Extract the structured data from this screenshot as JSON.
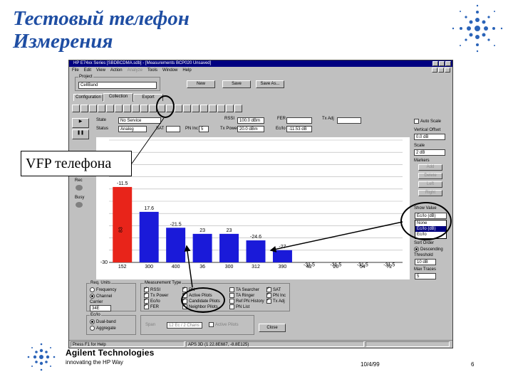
{
  "slide": {
    "title_line1": "Тестовый телефон",
    "title_line2": "Измерения",
    "callout": "VFP телефона",
    "footer": {
      "brand": "Agilent Technologies",
      "tagline": "innovating the HP Way",
      "date": "10/4/99",
      "page": "6"
    }
  },
  "window": {
    "title": "HP E74xx Series [SBDBCDMA.sdb] - [Measurements  BCP020  Unsaved]",
    "menu": [
      "File",
      "Edit",
      "View",
      "Action",
      "Analyze",
      "Tools",
      "Window",
      "Help"
    ],
    "project": {
      "label": "Project",
      "value": "CellBand",
      "buttons": [
        "New",
        "Save",
        "Save As..."
      ]
    },
    "tabs": [
      "Configuration",
      "Collection",
      "Export"
    ],
    "active_tab": "Collection",
    "fields": {
      "state_label": "State",
      "state_value": "No Service",
      "status_label": "Status",
      "status_value": "Analog",
      "sat_label": "SAT",
      "pn_inc_label": "PN Inc",
      "pn_inc_value": "5",
      "rssi_label": "RSSI",
      "rssi_value": "100.0 dBm",
      "tx_power_label": "Tx Power",
      "tx_power_value": "20.0 dBm",
      "fer_label": "FER",
      "ecio_label": "Ec/Io",
      "ecio_value": "-11.53 dB",
      "txadj_label": "Tx Adj"
    },
    "left_strip": [
      "Rec",
      "Busy"
    ],
    "right_panel": {
      "auto_scale": "Auto Scale",
      "vertical_offset_label": "Vertical Offset",
      "vertical_offset_value": "0.0 dB",
      "scale_label": "Scale",
      "scale_value": "2 dB",
      "markers_label": "Markers",
      "marker_buttons": [
        "Add",
        "Delete",
        "Left",
        "Right"
      ],
      "show_value_label": "Show Value",
      "show_value_selected": "Ec/Io (dB)",
      "show_value_options": [
        "None",
        "Ec/Io (dB)",
        "Ec/Io"
      ],
      "sort_label": "Sort Order",
      "sort_value": "Descending",
      "threshold_label": "Threshold",
      "threshold_value": "10 dB",
      "max_traces_label": "Max Traces",
      "max_traces_value": "5"
    },
    "req_units": {
      "label": "Req. Units",
      "options": [
        "Frequency",
        "Channel"
      ],
      "selected": "Channel",
      "carrier_label": "Carrier",
      "carrier_value": "34E"
    },
    "measurement_types": {
      "label": "Measurement Type",
      "items": [
        {
          "label": "RSSI",
          "on": true
        },
        {
          "label": "Tx Power",
          "on": true
        },
        {
          "label": "Ec/Io",
          "on": true
        },
        {
          "label": "FER",
          "on": true
        },
        {
          "label": "PN",
          "on": true
        },
        {
          "label": "Active Pilots",
          "on": true
        },
        {
          "label": "Candidate Pilots",
          "on": true
        },
        {
          "label": "Neighbor Pilots",
          "on": true
        },
        {
          "label": "TA Searcher",
          "on": false
        },
        {
          "label": "TA Ringer",
          "on": false
        },
        {
          "label": "Ref PN History",
          "on": false
        },
        {
          "label": "PN List",
          "on": false
        },
        {
          "label": "SAT",
          "on": true
        },
        {
          "label": "PN Inc",
          "on": true
        },
        {
          "label": "Tx Adj",
          "on": true
        }
      ]
    },
    "ecio_mode": {
      "label": "Ec/Io",
      "options": [
        "Dual-band",
        "Aggregate"
      ],
      "selected": "Dual-band"
    },
    "span": {
      "label": "Span",
      "value": "12 Ec / 2 Chans",
      "active_pilots": "Active Pilots"
    },
    "close_label": "Close",
    "status": {
      "left": "Press F1 for Help",
      "mid": "APS 3D (1 22.8E687, -8.8E125)"
    }
  },
  "chart_data": {
    "type": "bar",
    "categories": [
      "152",
      "300",
      "400",
      "36",
      "300",
      "312",
      "390",
      "42",
      "20",
      "54",
      "72"
    ],
    "values": [
      -11.5,
      -17.6,
      -21.5,
      -23,
      -23,
      -24.6,
      -27,
      -31.5,
      -31.5,
      -31.5,
      -31.5
    ],
    "value_labels": [
      "-11.5",
      "17.6",
      "-21.5",
      "23",
      "23",
      "-24.6",
      "-27",
      "-31.5",
      "-31.5",
      "-31.5",
      "-31.5"
    ],
    "bar_colors": [
      "#e8241a",
      "#1a1ad9",
      "#1a1ad9",
      "#1a1ad9",
      "#1a1ad9",
      "#1a1ad9",
      "#1a1ad9",
      "",
      "",
      "",
      ""
    ],
    "inner_label": "83",
    "ylim": [
      -30,
      0
    ],
    "ytick_labels": [
      "-30"
    ],
    "grid": true
  }
}
